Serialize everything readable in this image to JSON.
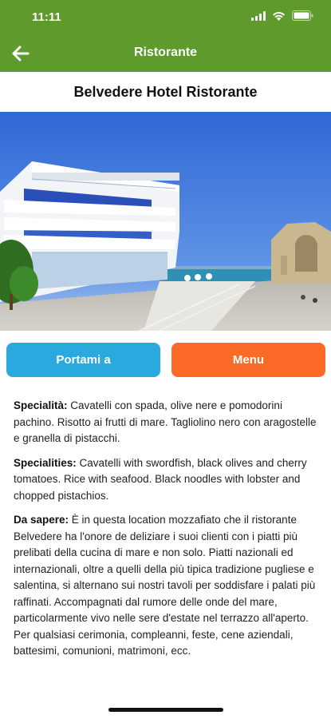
{
  "status": {
    "time": "11:11"
  },
  "nav": {
    "title": "Ristorante",
    "back_icon": "arrow-left-icon"
  },
  "page": {
    "title": "Belvedere Hotel Ristorante"
  },
  "buttons": {
    "directions_label": "Portami a",
    "menu_label": "Menu"
  },
  "content": {
    "specialita_label": "Specialità:",
    "specialita_text": " Cavatelli con spada, olive nere e pomodorini pachino. Risotto ai frutti di mare. Tagliolino nero con aragostelle e granella di pistacchi.",
    "specialities_label": "Specialities:",
    "specialities_text": " Cavatelli with swordfish, black olives and cherry tomatoes. Rice with seafood. Black noodles with lobster and chopped pistachios.",
    "da_sapere_label": "Da sapere:",
    "da_sapere_text": " È in questa location mozzafiato che il ristorante Belvedere ha l'onore de deliziare i suoi clienti con i piatti più prelibati della cucina di mare e non solo. Piatti nazionali ed internazionali, oltre a quelli della più tipica tradizione pugliese e salentina, si alternano sui nostri tavoli per soddisfare i palati più raffinati. Accompagnati dal rumore delle onde del mare, particolarmente vivo nelle sere d'estate nel terrazzo all'aperto. Per qualsiasi cerimonia, compleanni, feste, cene aziendali, battesimi, comunioni, matrimoni, ecc."
  },
  "colors": {
    "header_green": "#5e9a2c",
    "directions_blue": "#2aa9df",
    "menu_orange": "#fb6a26"
  }
}
